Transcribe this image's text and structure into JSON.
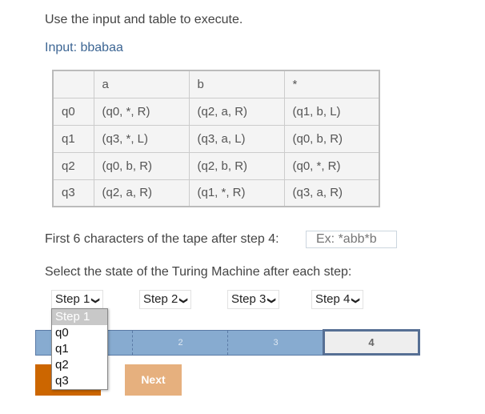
{
  "title": "Use the input and table to execute.",
  "input_label": "Input: bbabaa",
  "table": {
    "headers": [
      "",
      "a",
      "b",
      "*"
    ],
    "rows": [
      [
        "q0",
        "(q0, *, R)",
        "(q2, a, R)",
        "(q1, b, L)"
      ],
      [
        "q1",
        "(q3, *, L)",
        "(q3, a, L)",
        "(q0, b, R)"
      ],
      [
        "q2",
        "(q0, b, R)",
        "(q2, b, R)",
        "(q0, *, R)"
      ],
      [
        "q3",
        "(q2, a, R)",
        "(q1, *, R)",
        "(q3, a, R)"
      ]
    ]
  },
  "tape_question": "First 6 characters of the tape after step 4:",
  "tape_placeholder": "Ex: *abb*b",
  "state_question": "Select the state of the Turing Machine after each step:",
  "selects": [
    "Step 1",
    "Step 2",
    "Step 3",
    "Step 4"
  ],
  "dropdown_options": [
    "Step 1",
    "q0",
    "q1",
    "q2",
    "q3"
  ],
  "progress": {
    "segments": [
      "1",
      "2",
      "3",
      "4"
    ],
    "current": "4"
  },
  "next_label": "Next"
}
